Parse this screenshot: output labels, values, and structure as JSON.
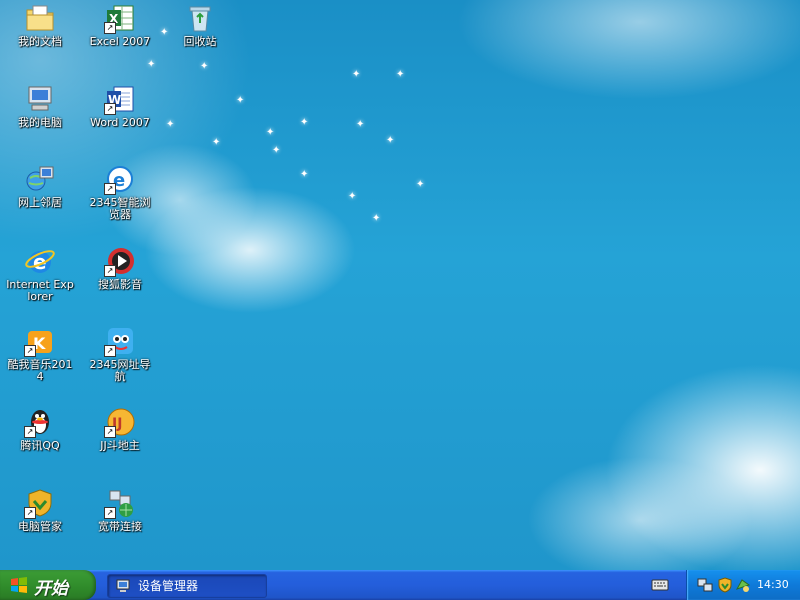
{
  "desktop": {
    "icons": [
      {
        "label": "我的文档",
        "icon": "folder-documents-icon",
        "shortcut": false
      },
      {
        "label": "Excel 2007",
        "icon": "excel-icon",
        "shortcut": true
      },
      {
        "label": "回收站",
        "icon": "recycle-bin-icon",
        "shortcut": false
      },
      {
        "label": "我的电脑",
        "icon": "computer-icon",
        "shortcut": false
      },
      {
        "label": "Word 2007",
        "icon": "word-icon",
        "shortcut": true
      },
      {
        "label": "网上邻居",
        "icon": "network-icon",
        "shortcut": false
      },
      {
        "label": "2345智能浏览器",
        "icon": "browser-2345-icon",
        "shortcut": true
      },
      {
        "label": "Internet Explorer",
        "icon": "ie-icon",
        "shortcut": false
      },
      {
        "label": "搜狐影音",
        "icon": "sohu-video-icon",
        "shortcut": true
      },
      {
        "label": "酷我音乐2014",
        "icon": "kuwo-music-icon",
        "shortcut": true
      },
      {
        "label": "2345网址导航",
        "icon": "nav-2345-icon",
        "shortcut": true
      },
      {
        "label": "腾讯QQ",
        "icon": "qq-icon",
        "shortcut": true
      },
      {
        "label": "JJ斗地主",
        "icon": "jj-game-icon",
        "shortcut": true
      },
      {
        "label": "电脑管家",
        "icon": "pc-manager-icon",
        "shortcut": true
      },
      {
        "label": "宽带连接",
        "icon": "broadband-icon",
        "shortcut": true
      }
    ]
  },
  "taskbar": {
    "start_label": "开始",
    "task_button_label": "设备管理器",
    "clock": "14:30"
  },
  "colors": {
    "taskbar": "#245edb",
    "start": "#2f8a2a",
    "tray": "#0f7ad9",
    "desktop": "#1f9dd0"
  }
}
